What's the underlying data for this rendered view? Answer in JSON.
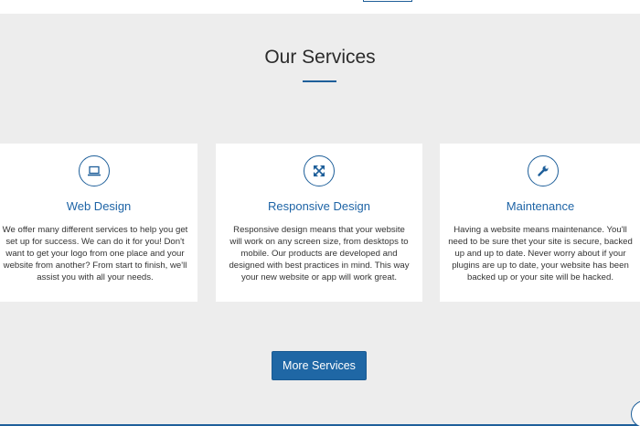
{
  "section": {
    "title": "Our Services",
    "accent_color": "#1e5f9a"
  },
  "services": [
    {
      "icon": "laptop-icon",
      "title": "Web Design",
      "description": "We offer many different services to help you get set up for success. We can do it for you! Don't want to get your logo from one place and your website from another? From start to finish, we'll assist you with all your needs."
    },
    {
      "icon": "expand-arrows-icon",
      "title": "Responsive Design",
      "description": "Responsive design means that your website will work on any screen size, from desktops to mobile. Our products are developed and designed with best practices in mind. This way your new website or app will work great."
    },
    {
      "icon": "wrench-icon",
      "title": "Maintenance",
      "description": "Having a website means maintenance. You'll need to be sure thet your site is secure, backed up and up to date. Never worry about if your plugins are up to date, your website has been backed up or your site will be hacked."
    }
  ],
  "cta": {
    "label": "More Services",
    "color": "#1f67a5"
  }
}
